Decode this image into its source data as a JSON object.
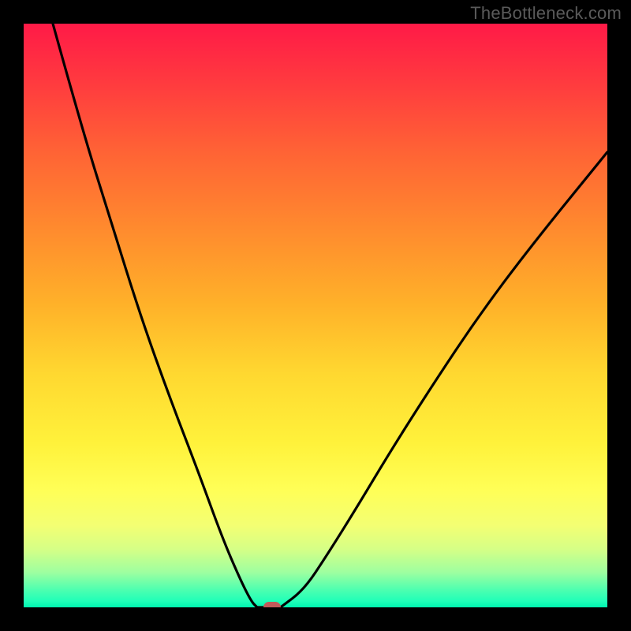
{
  "watermark": {
    "text": "TheBottleneck.com"
  },
  "colors": {
    "frame": "#000000",
    "curve": "#000000",
    "dot": "#c15a5a",
    "gradient": [
      "#ff1a47",
      "#ff3a3f",
      "#ff6335",
      "#ff8a2e",
      "#ffb129",
      "#ffd830",
      "#fff23b",
      "#ffff57",
      "#f3ff73",
      "#d6ff86",
      "#9effa0",
      "#4dffb0",
      "#1effb8",
      "#00f5b1"
    ]
  },
  "chart_data": {
    "type": "line",
    "title": "",
    "xlabel": "",
    "ylabel": "",
    "xlim": [
      0,
      100
    ],
    "ylim": [
      0,
      100
    ],
    "grid": false,
    "legend": false,
    "series": [
      {
        "name": "left-branch",
        "x": [
          5,
          10,
          15,
          20,
          25,
          30,
          34,
          37,
          39,
          40
        ],
        "y": [
          100,
          82,
          66,
          50,
          36,
          23,
          12,
          5,
          1,
          0
        ]
      },
      {
        "name": "valley",
        "x": [
          40,
          41,
          42,
          43,
          44
        ],
        "y": [
          0,
          0,
          0,
          0,
          0
        ]
      },
      {
        "name": "right-branch",
        "x": [
          44,
          48,
          52,
          57,
          63,
          70,
          78,
          87,
          100
        ],
        "y": [
          0,
          3,
          9,
          17,
          27,
          38,
          50,
          62,
          78
        ]
      }
    ],
    "marker": {
      "x": 42.5,
      "y": 0,
      "label": ""
    }
  }
}
